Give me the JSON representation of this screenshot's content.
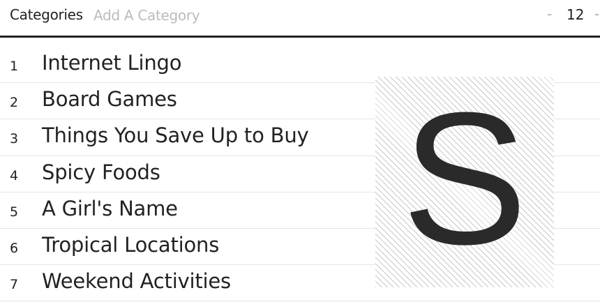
{
  "header": {
    "title": "Categories",
    "add_placeholder": "Add A Category",
    "minus_symbol": "-",
    "count": "12",
    "plus_symbol": "-"
  },
  "categories": [
    {
      "number": "1",
      "label": "Internet Lingo"
    },
    {
      "number": "2",
      "label": "Board Games"
    },
    {
      "number": "3",
      "label": "Things You Save Up to Buy"
    },
    {
      "number": "4",
      "label": "Spicy Foods"
    },
    {
      "number": "5",
      "label": "A Girl's Name"
    },
    {
      "number": "6",
      "label": "Tropical Locations"
    },
    {
      "number": "7",
      "label": "Weekend Activities"
    }
  ],
  "letter_card": {
    "letter": "S"
  },
  "colors": {
    "text": "#222222",
    "placeholder": "#bcbcbc",
    "divider": "#e4e4e4",
    "hatch": "#c9c9c9"
  }
}
